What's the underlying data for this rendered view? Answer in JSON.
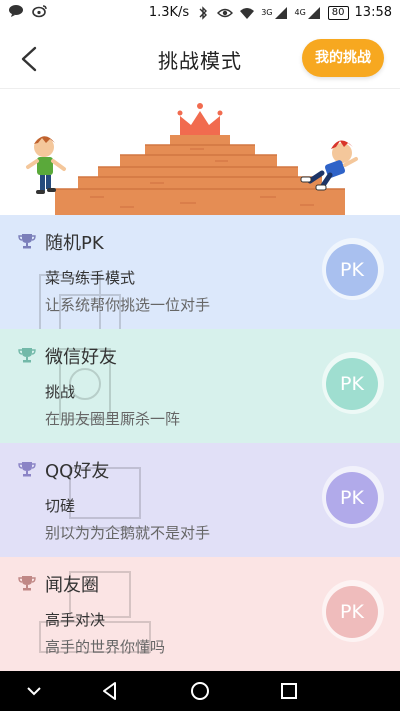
{
  "status_bar": {
    "network_speed": "1.3K/s",
    "signal_label_1": "3G",
    "signal_label_2": "4G",
    "battery": "80",
    "time": "13:58"
  },
  "header": {
    "title": "挑战模式",
    "my_challenge_label": "我的挑战"
  },
  "modes": [
    {
      "title": "随机PK",
      "subtitle": "菜鸟练手模式",
      "desc": "让系统帮你挑选一位对手",
      "pk_label": "PK",
      "bg": "#dce8fb",
      "trophy": "#7b7fba",
      "pk_color": "#a9c0ef"
    },
    {
      "title": "微信好友",
      "subtitle": "挑战",
      "desc": "在朋友圈里厮杀一阵",
      "pk_label": "PK",
      "bg": "#d7f1ec",
      "trophy": "#73b9a9",
      "pk_color": "#9fded0"
    },
    {
      "title": "QQ好友",
      "subtitle": "切磋",
      "desc": "别以为为企鹅就不是对手",
      "pk_label": "PK",
      "bg": "#e1e0f7",
      "trophy": "#8b84c6",
      "pk_color": "#b1aaea"
    },
    {
      "title": "闻友圈",
      "subtitle": "高手对决",
      "desc": "高手的世界你懂吗",
      "pk_label": "PK",
      "bg": "#fbe4e4",
      "trophy": "#c08886",
      "pk_color": "#efbcbc"
    }
  ]
}
